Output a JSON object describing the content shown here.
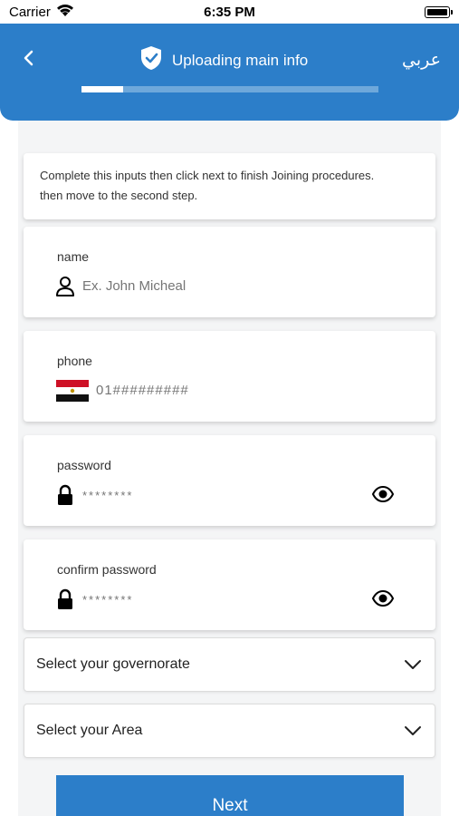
{
  "status_bar": {
    "carrier": "Carrier",
    "time": "6:35 PM"
  },
  "header": {
    "title": "Uploading main info",
    "language_toggle": "عربي",
    "progress": 0.14
  },
  "intro": {
    "line1": "Complete this inputs then click next to finish Joining procedures.",
    "line2": "then move to the second step."
  },
  "form": {
    "name": {
      "label": "name",
      "placeholder": "Ex. John Micheal"
    },
    "phone": {
      "label": "phone",
      "placeholder": "01#########"
    },
    "password": {
      "label": "password",
      "placeholder": "********"
    },
    "confirm_password": {
      "label": "confirm password",
      "placeholder": "********"
    },
    "governorate": {
      "text": "Select your governorate"
    },
    "area": {
      "text": "Select your Area"
    }
  },
  "next_label": "Next",
  "colors": {
    "primary": "#2c7ec9",
    "background": "#f4f5f6"
  }
}
